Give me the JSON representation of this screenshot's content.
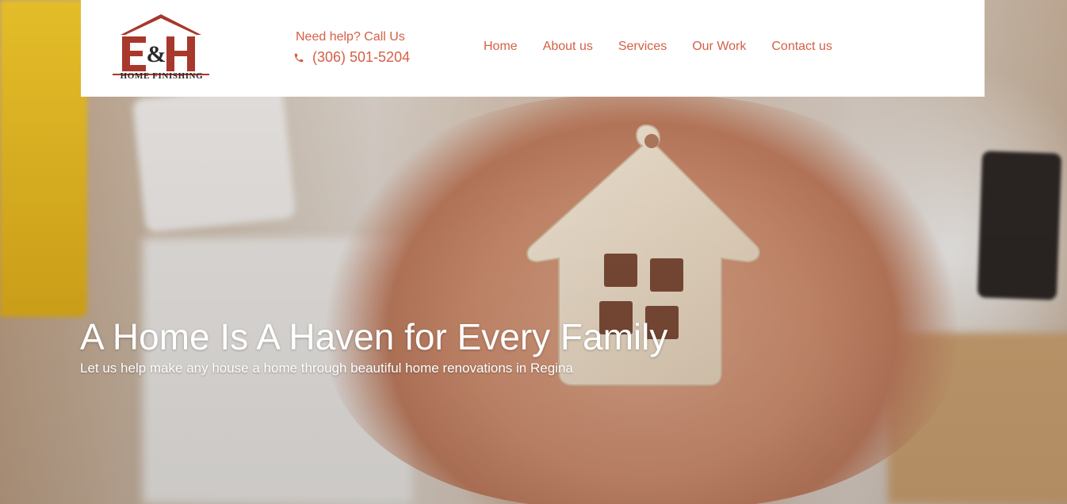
{
  "header": {
    "logo_text": "HOME FINISHING",
    "help_text": "Need help? Call Us",
    "phone": "(306) 501-5204"
  },
  "nav": {
    "items": [
      {
        "label": "Home"
      },
      {
        "label": "About us"
      },
      {
        "label": "Services"
      },
      {
        "label": "Our Work"
      },
      {
        "label": "Contact us"
      }
    ]
  },
  "hero": {
    "title": "A Home Is A Haven for Every Family",
    "subtitle": "Let us help make any house a home through beautiful home renovations in Regina"
  },
  "colors": {
    "accent": "#d65f45",
    "logo_red": "#a8382c",
    "header_bg": "#ffffff",
    "hero_text": "#ffffff"
  },
  "icons": {
    "phone": "phone-icon",
    "logo": "logo-icon"
  }
}
